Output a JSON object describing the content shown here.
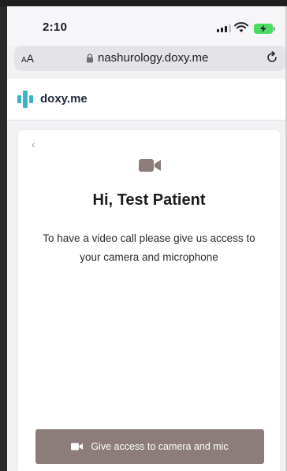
{
  "status_bar": {
    "time": "2:10"
  },
  "browser": {
    "text_size_label_small": "A",
    "text_size_label_large": "A",
    "url": "nashurology.doxy.me"
  },
  "site": {
    "logo_text": "doxy.me",
    "brand_color": "#3ab4c0"
  },
  "card": {
    "heading": "Hi, Test Patient",
    "description": "To have a video call please give us access to your camera and microphone",
    "button_label": "Give access to camera and mic",
    "button_color": "#8c7d7a"
  }
}
